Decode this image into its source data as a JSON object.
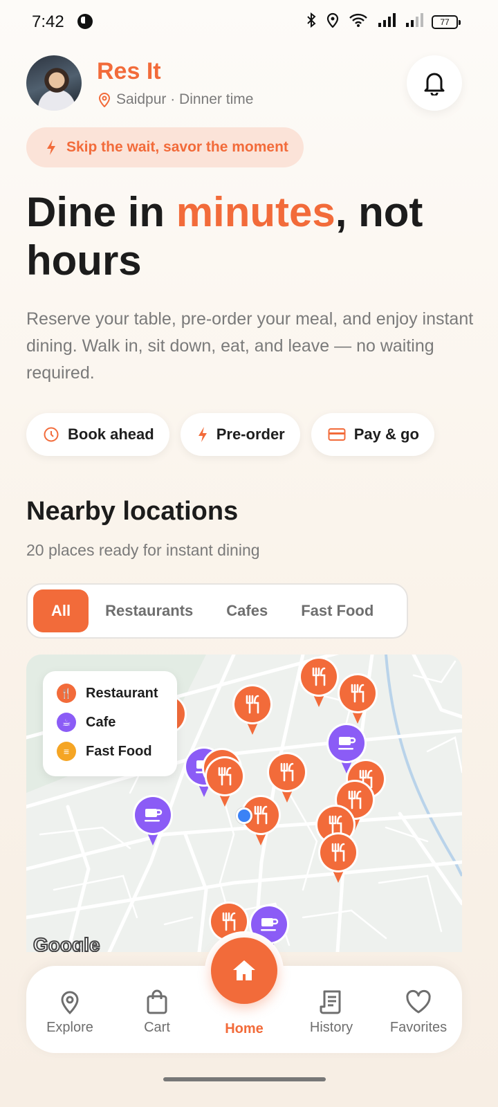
{
  "status_bar": {
    "time": "7:42",
    "battery": "77"
  },
  "header": {
    "app_name": "Res It",
    "location": "Saidpur · Dinner time"
  },
  "tagline": "Skip the wait, savor the moment",
  "hero": {
    "part1": "Dine in ",
    "accent": "minutes",
    "part2": ", not hours"
  },
  "description": "Reserve your table, pre-order your meal, and enjoy instant dining. Walk in, sit down, eat, and leave — no waiting required.",
  "chips": [
    {
      "label": "Book ahead",
      "icon": "clock-icon"
    },
    {
      "label": "Pre-order",
      "icon": "bolt-icon"
    },
    {
      "label": "Pay & go",
      "icon": "card-icon"
    }
  ],
  "nearby": {
    "title": "Nearby locations",
    "subtitle": "20 places ready for instant dining"
  },
  "filters": [
    {
      "label": "All",
      "active": true
    },
    {
      "label": "Restaurants",
      "active": false
    },
    {
      "label": "Cafes",
      "active": false
    },
    {
      "label": "Fast Food",
      "active": false
    }
  ],
  "map": {
    "legend": [
      {
        "label": "Restaurant",
        "color": "#f26b3a",
        "icon": "fork-knife-icon"
      },
      {
        "label": "Cafe",
        "color": "#8b5cf6",
        "icon": "cup-icon"
      },
      {
        "label": "Fast Food",
        "color": "#f5a524",
        "icon": "burger-icon"
      }
    ],
    "attribution": "Google"
  },
  "bottom_nav": [
    {
      "label": "Explore",
      "icon": "map-pin-icon",
      "active": false
    },
    {
      "label": "Cart",
      "icon": "bag-icon",
      "active": false
    },
    {
      "label": "Home",
      "icon": "home-icon",
      "active": true
    },
    {
      "label": "History",
      "icon": "receipt-icon",
      "active": false
    },
    {
      "label": "Favorites",
      "icon": "heart-icon",
      "active": false
    }
  ],
  "colors": {
    "accent": "#f26b3a",
    "cafe": "#8b5cf6",
    "fastfood": "#f5a524",
    "user_location": "#3b82f6"
  }
}
